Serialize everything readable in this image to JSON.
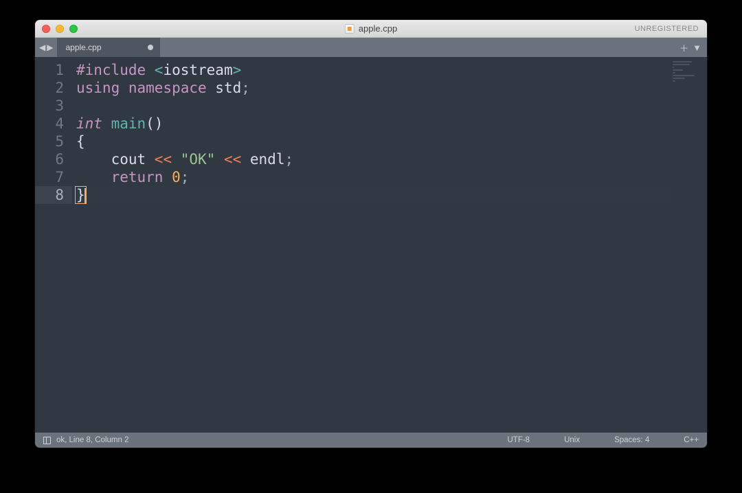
{
  "titlebar": {
    "title": "apple.cpp",
    "unregistered": "UNREGISTERED"
  },
  "tabbar": {
    "tabs": [
      {
        "label": "apple.cpp",
        "dirty": true
      }
    ]
  },
  "editor": {
    "active_line": 8,
    "lines": [
      {
        "n": 1,
        "tokens": [
          {
            "t": "#include ",
            "c": "kw-pre"
          },
          {
            "t": "<",
            "c": "angle"
          },
          {
            "t": "iostream",
            "c": "kw-lib"
          },
          {
            "t": ">",
            "c": "angle"
          }
        ]
      },
      {
        "n": 2,
        "tokens": [
          {
            "t": "using ",
            "c": "kw-pre"
          },
          {
            "t": "namespace ",
            "c": "kw-pre"
          },
          {
            "t": "std",
            "c": "kw-ns"
          },
          {
            "t": ";",
            "c": "semi"
          }
        ]
      },
      {
        "n": 3,
        "tokens": []
      },
      {
        "n": 4,
        "tokens": [
          {
            "t": "int ",
            "c": "kw-type"
          },
          {
            "t": "main",
            "c": "fn"
          },
          {
            "t": "()",
            "c": "paren"
          }
        ]
      },
      {
        "n": 5,
        "tokens": [
          {
            "t": "{",
            "c": "brace"
          }
        ]
      },
      {
        "n": 6,
        "tokens": [
          {
            "t": "    ",
            "c": ""
          },
          {
            "t": "cout ",
            "c": "ident"
          },
          {
            "t": "<< ",
            "c": "op"
          },
          {
            "t": "\"OK\"",
            "c": "str"
          },
          {
            "t": " << ",
            "c": "op"
          },
          {
            "t": "endl",
            "c": "ident"
          },
          {
            "t": ";",
            "c": "semi"
          }
        ]
      },
      {
        "n": 7,
        "tokens": [
          {
            "t": "    ",
            "c": ""
          },
          {
            "t": "return ",
            "c": "kw-ctrl"
          },
          {
            "t": "0",
            "c": "num"
          },
          {
            "t": ";",
            "c": "semi"
          }
        ]
      },
      {
        "n": 8,
        "tokens": [
          {
            "t": "}",
            "c": "brace brace-hl"
          }
        ],
        "cursor_after": true
      }
    ]
  },
  "statusbar": {
    "left": "ok, Line 8, Column 2",
    "encoding": "UTF-8",
    "lineending": "Unix",
    "indent": "Spaces: 4",
    "syntax": "C++"
  }
}
